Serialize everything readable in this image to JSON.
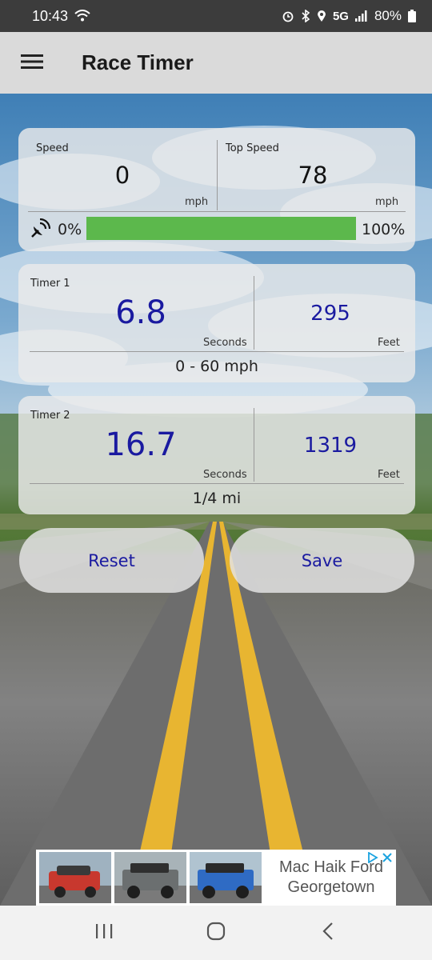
{
  "status_bar": {
    "time": "10:43",
    "network": "5G",
    "battery": "80%"
  },
  "app_bar": {
    "title": "Race Timer"
  },
  "speed_card": {
    "speed_label": "Speed",
    "speed_value": "0",
    "speed_unit": "mph",
    "top_speed_label": "Top Speed",
    "top_speed_value": "78",
    "top_speed_unit": "mph",
    "gps_min_label": "0%",
    "gps_max_label": "100%",
    "gps_signal_percent": 100
  },
  "timer1": {
    "label": "Timer 1",
    "time_value": "6.8",
    "time_unit": "Seconds",
    "distance_value": "295",
    "distance_unit": "Feet",
    "range": "0 - 60  mph"
  },
  "timer2": {
    "label": "Timer 2",
    "time_value": "16.7",
    "time_unit": "Seconds",
    "distance_value": "1319",
    "distance_unit": "Feet",
    "range": "1/4 mi"
  },
  "actions": {
    "reset_label": "Reset",
    "save_label": "Save"
  },
  "ad": {
    "line1": "Mac Haik Ford",
    "line2": "Georgetown"
  },
  "colors": {
    "accent": "#1a1aa0",
    "progress": "#5cb84c",
    "app_bar": "#dadada"
  }
}
